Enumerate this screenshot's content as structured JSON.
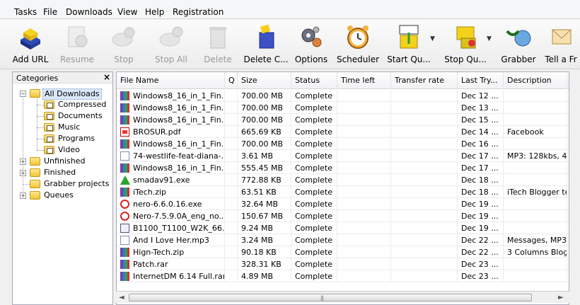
{
  "menu": [
    "Tasks",
    "File",
    "Downloads",
    "View",
    "Help",
    "Registration"
  ],
  "toolbar": [
    {
      "label": "Add URL",
      "icon": "add-url-icon",
      "enabled": true
    },
    {
      "label": "Resume",
      "icon": "resume-icon",
      "enabled": false
    },
    {
      "label": "Stop",
      "icon": "stop-icon",
      "enabled": false
    },
    {
      "label": "Stop All",
      "icon": "stop-all-icon",
      "enabled": false
    },
    {
      "label": "Delete",
      "icon": "delete-icon",
      "enabled": false
    },
    {
      "label": "Delete C...",
      "icon": "delete-completed-icon",
      "enabled": true
    },
    {
      "label": "Options",
      "icon": "options-gear-icon",
      "enabled": true
    },
    {
      "label": "Scheduler",
      "icon": "alarm-clock-icon",
      "enabled": true
    },
    {
      "label": "Start Qu...",
      "icon": "start-queue-icon",
      "enabled": true
    },
    {
      "label": "Stop Qu...",
      "icon": "stop-queue-icon",
      "enabled": true
    },
    {
      "label": "Grabber",
      "icon": "grabber-icon",
      "enabled": true
    },
    {
      "label": "Tell a Fr",
      "icon": "tell-friend-icon",
      "enabled": true
    }
  ],
  "categories": {
    "title": "Categories",
    "close_glyph": "×",
    "items": [
      {
        "label": "All Downloads",
        "icon": "folder-open-icon",
        "selected": true
      },
      {
        "label": "Compressed",
        "icon": "compressed-folder-icon"
      },
      {
        "label": "Documents",
        "icon": "documents-folder-icon"
      },
      {
        "label": "Music",
        "icon": "music-folder-icon"
      },
      {
        "label": "Programs",
        "icon": "programs-folder-icon"
      },
      {
        "label": "Video",
        "icon": "video-folder-icon"
      },
      {
        "label": "Unfinished",
        "icon": "unfinished-folder-icon"
      },
      {
        "label": "Finished",
        "icon": "finished-folder-icon"
      },
      {
        "label": "Grabber projects",
        "icon": "grabber-projects-icon"
      },
      {
        "label": "Queues",
        "icon": "queues-folder-icon"
      }
    ]
  },
  "columns": [
    "File Name",
    "Q",
    "Size",
    "Status",
    "Time left",
    "Transfer rate",
    "Last Try...",
    "Description"
  ],
  "rows": [
    {
      "name": "Windows8_16_in_1_Fin...",
      "icon": "rar",
      "size": "700.00 MB",
      "status": "Complete",
      "last_try": "Dec 12 ...",
      "desc": ""
    },
    {
      "name": "Windows8_16_in_1_Fin...",
      "icon": "rar",
      "size": "700.00 MB",
      "status": "Complete",
      "last_try": "Dec 13 ...",
      "desc": ""
    },
    {
      "name": "Windows8_16_in_1_Fin...",
      "icon": "rar",
      "size": "700.00 MB",
      "status": "Complete",
      "last_try": "Dec 15 ...",
      "desc": ""
    },
    {
      "name": "BROSUR.pdf",
      "icon": "pdf",
      "size": "665.69 KB",
      "status": "Complete",
      "last_try": "Dec 14 ...",
      "desc": "Facebook"
    },
    {
      "name": "Windows8_16_in_1_Fin...",
      "icon": "rar",
      "size": "700.00 MB",
      "status": "Complete",
      "last_try": "Dec 16 ...",
      "desc": ""
    },
    {
      "name": "74-westlife-feat-diana-...",
      "icon": "mp3",
      "size": "3.61 MB",
      "status": "Complete",
      "last_try": "Dec 17 ...",
      "desc": "MP3: 128kbs, 44k"
    },
    {
      "name": "Windows8_16_in_1_Fin...",
      "icon": "rar",
      "size": "555.45 MB",
      "status": "Complete",
      "last_try": "Dec 17 ...",
      "desc": ""
    },
    {
      "name": "smadav91.exe",
      "icon": "exe-green",
      "size": "772.88 KB",
      "status": "Complete",
      "last_try": "Dec 18 ...",
      "desc": ""
    },
    {
      "name": "iTech.zip",
      "icon": "rar",
      "size": "63.51 KB",
      "status": "Complete",
      "last_try": "Dec 18 ...",
      "desc": "iTech Blogger tem"
    },
    {
      "name": "nero-6.6.0.16.exe",
      "icon": "exe-red",
      "size": "32.64 MB",
      "status": "Complete",
      "last_try": "Dec 19 ...",
      "desc": ""
    },
    {
      "name": "Nero-7.5.9.0A_eng_no...",
      "icon": "exe-red",
      "size": "150.67 MB",
      "status": "Complete",
      "last_try": "Dec 19 ...",
      "desc": ""
    },
    {
      "name": "B1100_T1100_W2K_66...",
      "icon": "exe",
      "size": "9.24 MB",
      "status": "Complete",
      "last_try": "Dec 19 ...",
      "desc": ""
    },
    {
      "name": "And I Love Her.mp3",
      "icon": "mp3",
      "size": "3.24 MB",
      "status": "Complete",
      "last_try": "Dec 22 ...",
      "desc": "Messages, MP3: 1"
    },
    {
      "name": "Hign-Tech.zip",
      "icon": "rar",
      "size": "90.18 KB",
      "status": "Complete",
      "last_try": "Dec 22 ...",
      "desc": "3 Columns Blogge"
    },
    {
      "name": "Patch.rar",
      "icon": "rar",
      "size": "328.31 KB",
      "status": "Complete",
      "last_try": "Dec 23 ...",
      "desc": ""
    },
    {
      "name": "InternetDM 6.14 Full.rar",
      "icon": "rar",
      "size": "4.89 MB",
      "status": "Complete",
      "last_try": "Dec 23 ...",
      "desc": ""
    }
  ],
  "scrollbar": {
    "left": "◄",
    "right": "►",
    "grip": "|||"
  }
}
